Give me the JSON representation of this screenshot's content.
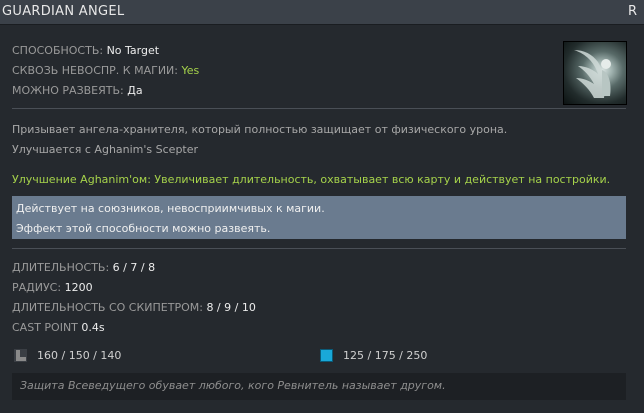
{
  "header": {
    "title": "GUARDIAN ANGEL",
    "hotkey": "R"
  },
  "properties": [
    {
      "label": "СПОСОБНОСТЬ:",
      "value": "No Target",
      "color": "#ececec"
    },
    {
      "label": "СКВОЗЬ НЕВОСПР. К МАГИИ:",
      "value": "Yes",
      "color": "#a6d34b"
    },
    {
      "label": "МОЖНО РАЗВЕЯТЬ:",
      "value": "Да",
      "color": "#ececec"
    }
  ],
  "icon": {
    "name": "guardian-angel-ability-icon"
  },
  "description": {
    "line1": "Призывает ангела-хранителя, который полностью защищает от физического урона.",
    "line2": "Улучшается с Aghanim's Scepter"
  },
  "upgrade": "Улучшение Aghanim'ом: Увеличивает длительность, охватывает всю карту и действует на постройки.",
  "notes": [
    "Действует на союзников, невосприимчивых к магии.",
    "Эффект этой способности можно развеять."
  ],
  "stats": [
    {
      "label": "ДЛИТЕЛЬНОСТЬ:",
      "value": "6 / 7 / 8"
    },
    {
      "label": "РАДИУС:",
      "value": "1200"
    },
    {
      "label": "ДЛИТЕЛЬНОСТЬ СО СКИПЕТРОМ:",
      "value": "8 / 9 / 10"
    },
    {
      "label": "CAST POINT",
      "value": "0.4s"
    }
  ],
  "costs": {
    "cooldown": {
      "icon": "cooldown-icon",
      "value": "160 / 150 / 140"
    },
    "mana": {
      "icon": "mana-icon",
      "value": "125 / 175 / 250"
    }
  },
  "lore": "Защита Всеведущего обувает любого, кого Ревнитель называет другом.",
  "colors": {
    "background": "#25292e",
    "titlebar": "#3b4149",
    "accent_green": "#a6d34b",
    "notes_bg": "#6a7b8f",
    "mana_blue": "#19a8d8"
  }
}
